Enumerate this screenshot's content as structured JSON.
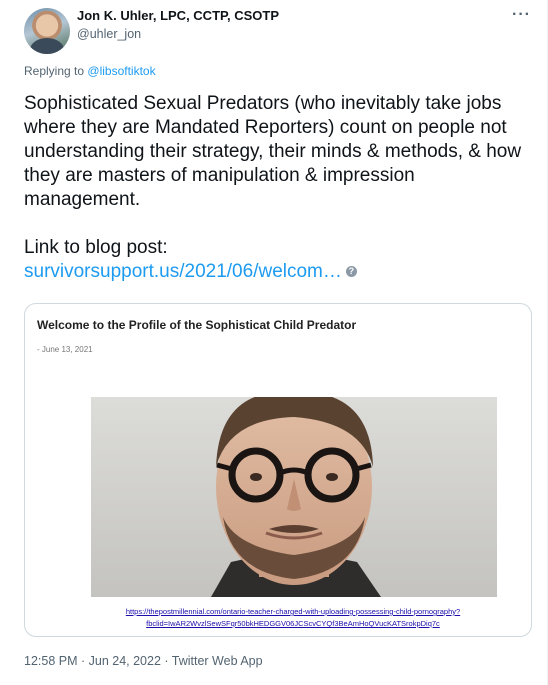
{
  "author": {
    "name": "Jon K. Uhler, LPC, CCTP, CSOTP",
    "handle": "@uhler_jon",
    "more_icon": "more-horizontal-icon"
  },
  "reply": {
    "prefix": "Replying to",
    "to": "@libsoftiktok"
  },
  "tweet": {
    "text": "Sophisticated Sexual Predators (who inevitably take jobs where they are Mandated Reporters) count on people not understanding their strategy, their minds & methods, & how they are masters of manipulation & impression management.",
    "link_label": "Link to blog post:",
    "link_url": "survivorsupport.us/2021/06/welcom…",
    "link_icon": "question-icon",
    "link_icon_glyph": "?"
  },
  "card": {
    "title": "Welcome to the Profile of the Sophisticat Child Predator",
    "date": "- June 13, 2021",
    "source_link_line1": "https://thepostmillennial.com/ontario-teacher-charged-with-uploading-possessing-child-pornography?",
    "source_link_line2": "fbclid=IwAR2WvzlSewSFqr50bkHEDGGV06JCScvCYQf3BeAmHoQVucKATSrokpDiq7c"
  },
  "meta": {
    "timestamp": "12:58 PM · Jun 24, 2022 · Twitter Web App"
  },
  "colors": {
    "link": "#1d9bf0",
    "secondary_text": "#536471",
    "primary_text": "#0f1419",
    "border": "#cfd9de"
  }
}
